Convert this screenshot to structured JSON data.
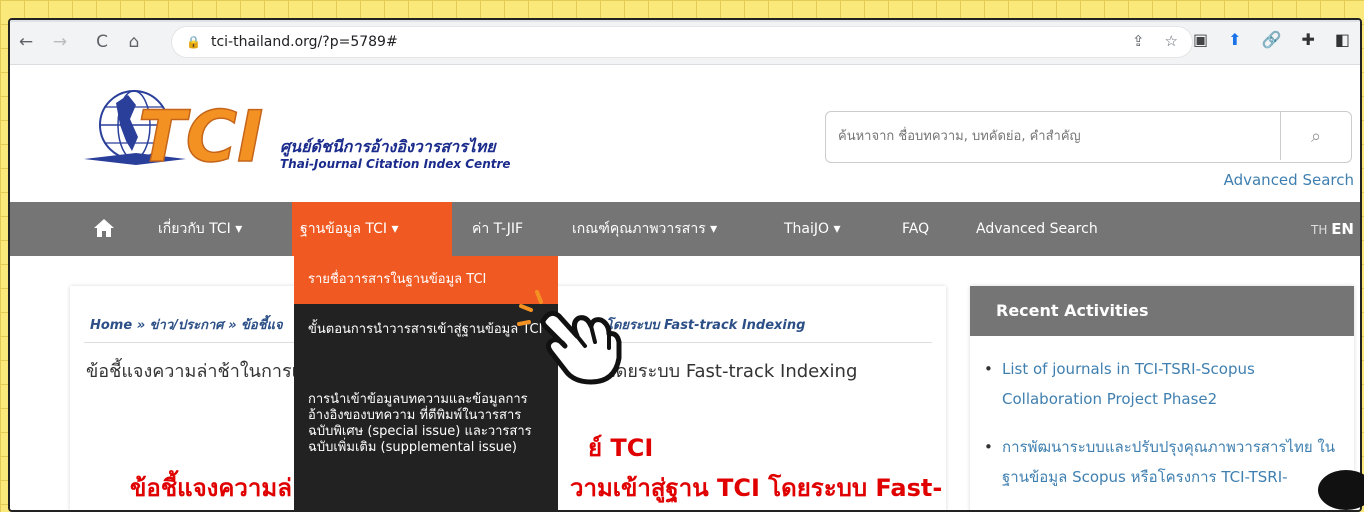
{
  "browser": {
    "url": "tci-thailand.org/?p=5789#"
  },
  "header": {
    "brand_thai": "ศูนย์ดัชนีการอ้างอิงวารสารไทย",
    "brand_en": "Thai-Journal Citation Index Centre",
    "logo_text": "TCI",
    "search_placeholder": "ค้นหาจาก ชื่อบทความ, บทคัดย่อ, คำสำคัญ",
    "advanced_search_link": "Advanced Search"
  },
  "nav": {
    "items": [
      {
        "label": "เกี่ยวกับ TCI ▾"
      },
      {
        "label": "ฐานข้อมูล TCI ▾"
      },
      {
        "label": "ค่า T-JIF"
      },
      {
        "label": "เกณฑ์คุณภาพวารสาร ▾"
      },
      {
        "label": "ThaiJO ▾"
      },
      {
        "label": "FAQ"
      },
      {
        "label": "Advanced Search"
      }
    ],
    "lang_th": "TH",
    "lang_en": "EN"
  },
  "dropdown": {
    "items": [
      {
        "label": "รายชื่อวารสารในฐานข้อมูล TCI"
      },
      {
        "label": "ขั้นตอนการนำวารสารเข้าสู่ฐานข้อมูล TCI"
      },
      {
        "label": "การนำเข้าข้อมูลบทความและข้อมูลการอ้างอิงของบทความ ที่ตีพิมพ์ในวารสารฉบับพิเศษ (special issue) และวารสารฉบับเพิ่มเติม (supplemental issue)"
      }
    ]
  },
  "content": {
    "breadcrumb_left": "Home » ข่าว/ประกาศ » ข้อชี้แจ",
    "breadcrumb_right": "โดยระบบ Fast-track Indexing",
    "title_left": "ข้อชี้แจงความล่าช้าในการเ",
    "title_right": "โดยระบบ Fast-track Indexing",
    "red_heading_right": "ย์ TCI",
    "red_line_left": "ข้อชี้แจงความล่",
    "red_line_right": "วามเข้าสู่ฐาน TCI โดยระบบ Fast-"
  },
  "sidebar": {
    "title": "Recent Activities",
    "items": [
      {
        "label": "List of journals in TCI-TSRI-Scopus Collaboration Project Phase2"
      },
      {
        "label": "การพัฒนาระบบและปรับปรุงคุณภาพวารสารไทย ในฐานข้อมูล Scopus หรือโครงการ TCI-TSRI-"
      }
    ]
  },
  "colors": {
    "accent": "#f05a22",
    "nav_bg": "#757575",
    "link": "#3f7fb0",
    "heading_red": "#e00000",
    "background": "#fbe87a"
  }
}
